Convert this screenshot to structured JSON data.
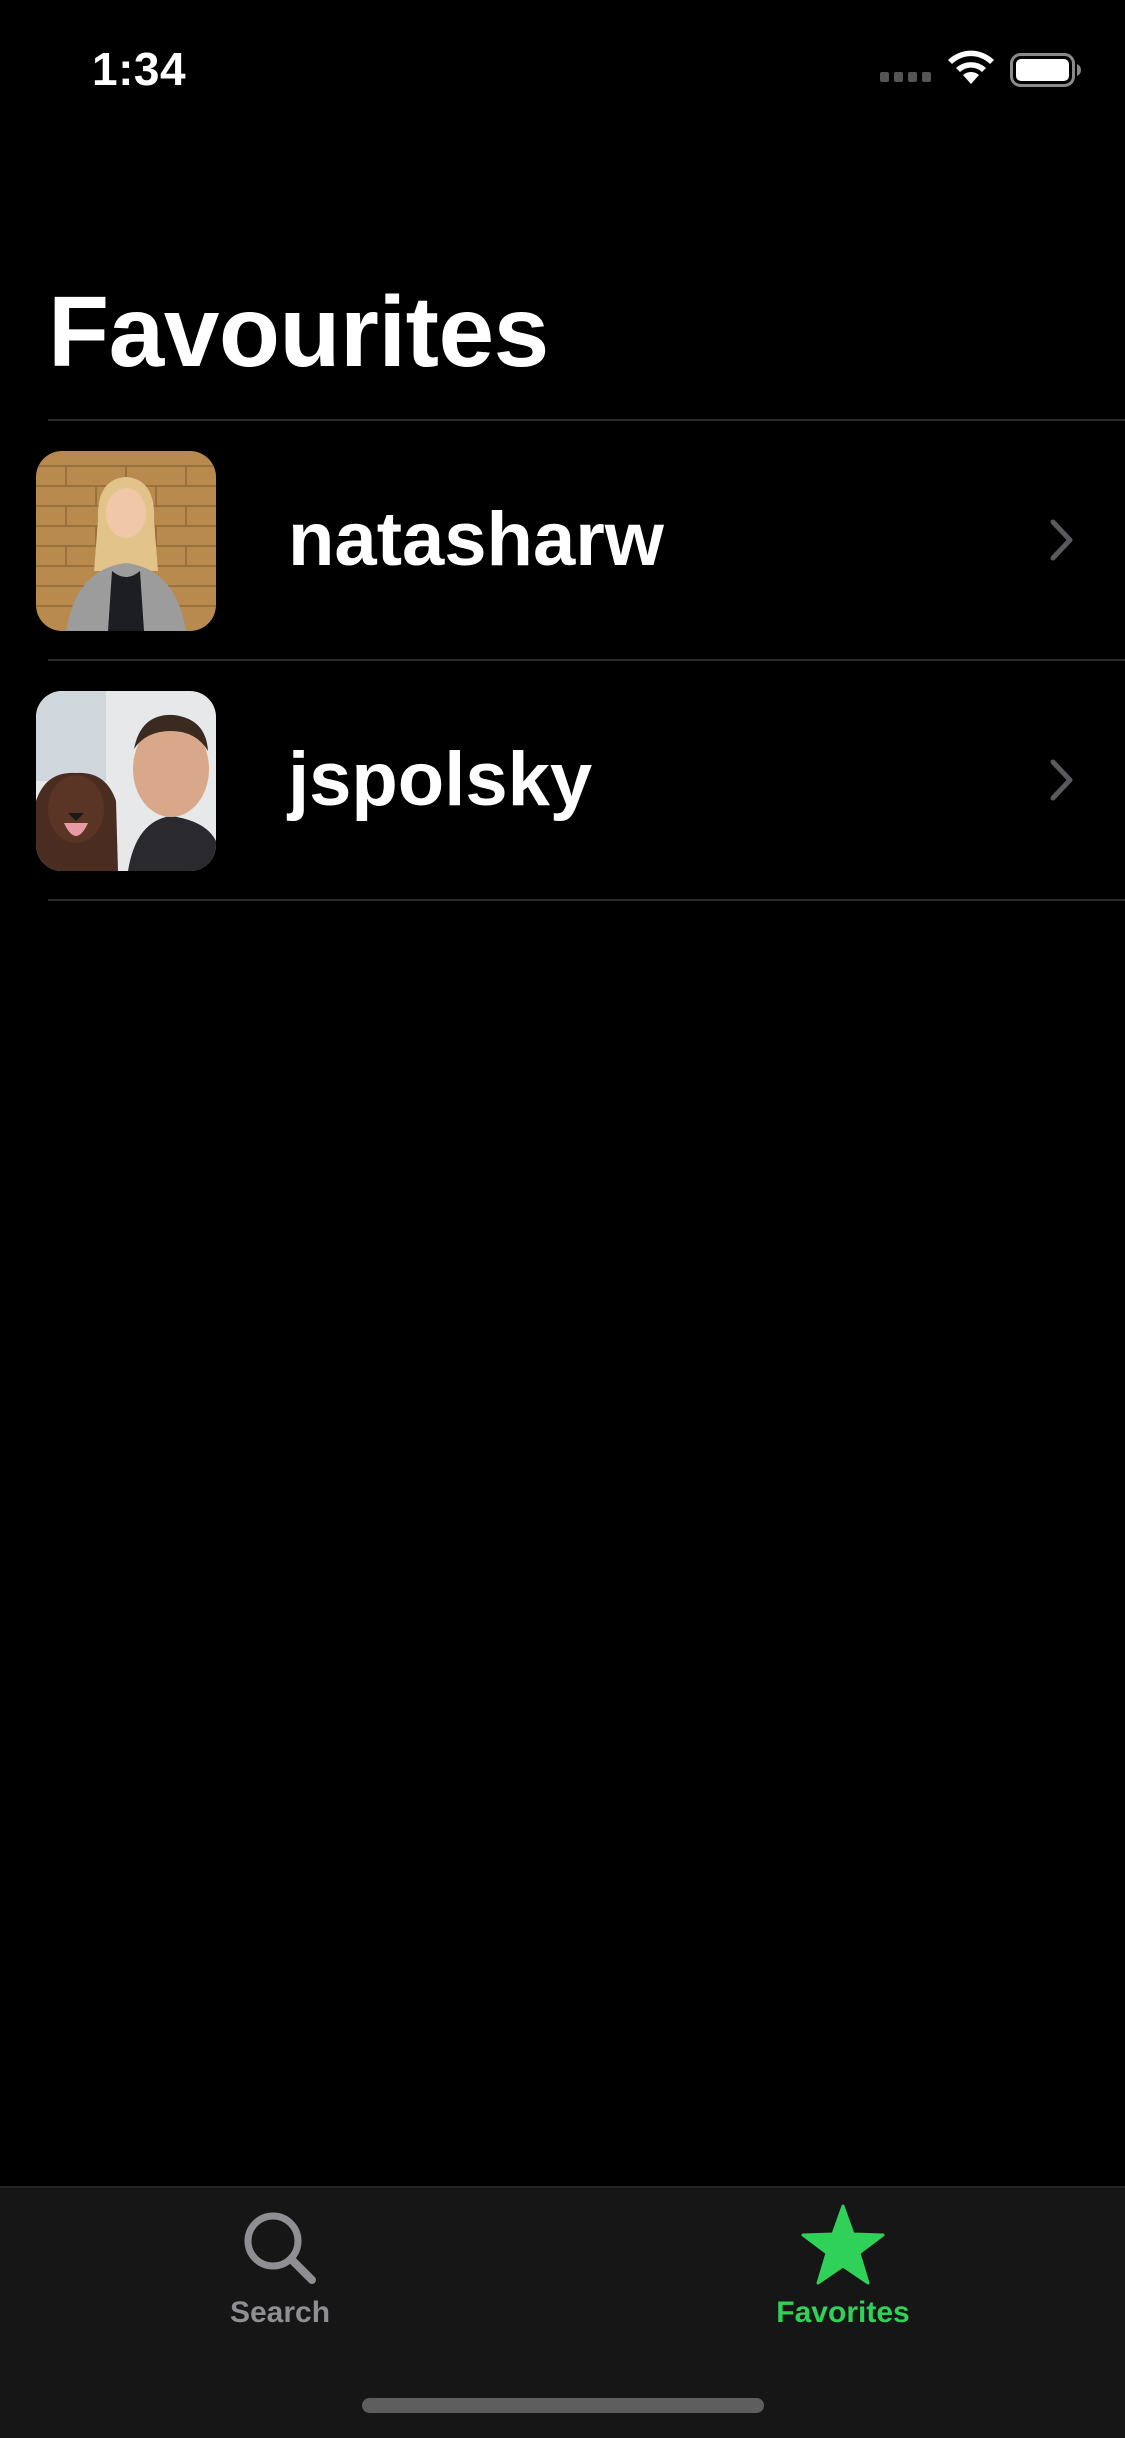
{
  "status_bar": {
    "time": "1:34"
  },
  "page": {
    "title": "Favourites"
  },
  "favorites": [
    {
      "username": "natasharw",
      "avatar": "avatar-woman-brick-wall"
    },
    {
      "username": "jspolsky",
      "avatar": "avatar-man-with-dog"
    }
  ],
  "tab_bar": {
    "tabs": [
      {
        "label": "Search",
        "icon": "search-icon",
        "selected": false
      },
      {
        "label": "Favorites",
        "icon": "star-icon",
        "selected": true
      }
    ]
  },
  "colors": {
    "background": "#000000",
    "accent": "#30d158",
    "inactive_tab": "#8e8e93",
    "tab_bar_background": "#161616"
  }
}
